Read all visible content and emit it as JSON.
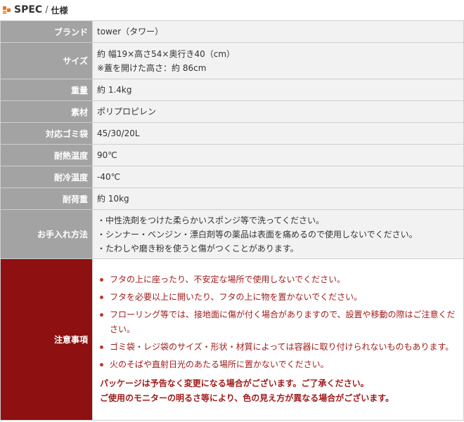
{
  "header": {
    "title": "SPEC",
    "separator": "/",
    "subtitle": "仕様"
  },
  "rows": [
    {
      "label": "ブランド",
      "lines": [
        "tower（タワー）"
      ]
    },
    {
      "label": "サイズ",
      "lines": [
        "約 幅19×高さ54×奥行き40（cm）",
        "※蓋を開けた高さ：約 86cm"
      ]
    },
    {
      "label": "重量",
      "lines": [
        "約 1.4kg"
      ]
    },
    {
      "label": "素材",
      "lines": [
        "ポリプロピレン"
      ]
    },
    {
      "label": "対応ゴミ袋",
      "lines": [
        "45/30/20L"
      ]
    },
    {
      "label": "耐熱温度",
      "lines": [
        "90℃"
      ]
    },
    {
      "label": "耐冷温度",
      "lines": [
        "-40℃"
      ]
    },
    {
      "label": "耐荷重",
      "lines": [
        "約 10kg"
      ]
    },
    {
      "label": "お手入れ方法",
      "lines": [
        "・中性洗剤をつけた柔らかいスポンジ等で洗ってください。",
        "・シンナー・ベンジン・漂白剤等の薬品は表面を痛めるので使用しないでください。",
        "・たわしや磨き粉を使うと傷がつくことがあります。"
      ]
    }
  ],
  "cautions": {
    "label": "注意事項",
    "items": [
      "フタの上に座ったり、不安定な場所で使用しないでください。",
      "フタを必要以上に開いたり、フタの上に物を置かないでください。",
      "フローリング等では、接地面に傷が付く場合がありますので、設置や移動の際はご注意ください。",
      "ゴミ袋・レジ袋のサイズ・形状・材質によっては容器に取り付けられないものもあります。",
      "火のそばや直射日光のあたる場所に置かないでください。"
    ],
    "notices": [
      "パッケージは予告なく変更になる場合がございます。ご了承ください。",
      "ご使用のモニターの明るさ等により、色の見え方が異なる場合がございます。"
    ]
  },
  "colors": {
    "header_cell": "#a3a3a3",
    "caution_header_cell": "#8e1010",
    "caution_text": "#a11b1b",
    "icon_accent": "#e8731e"
  },
  "icons": {
    "header_icon": "orange-squares-icon",
    "caution_bullet": "red-dot-icon"
  }
}
